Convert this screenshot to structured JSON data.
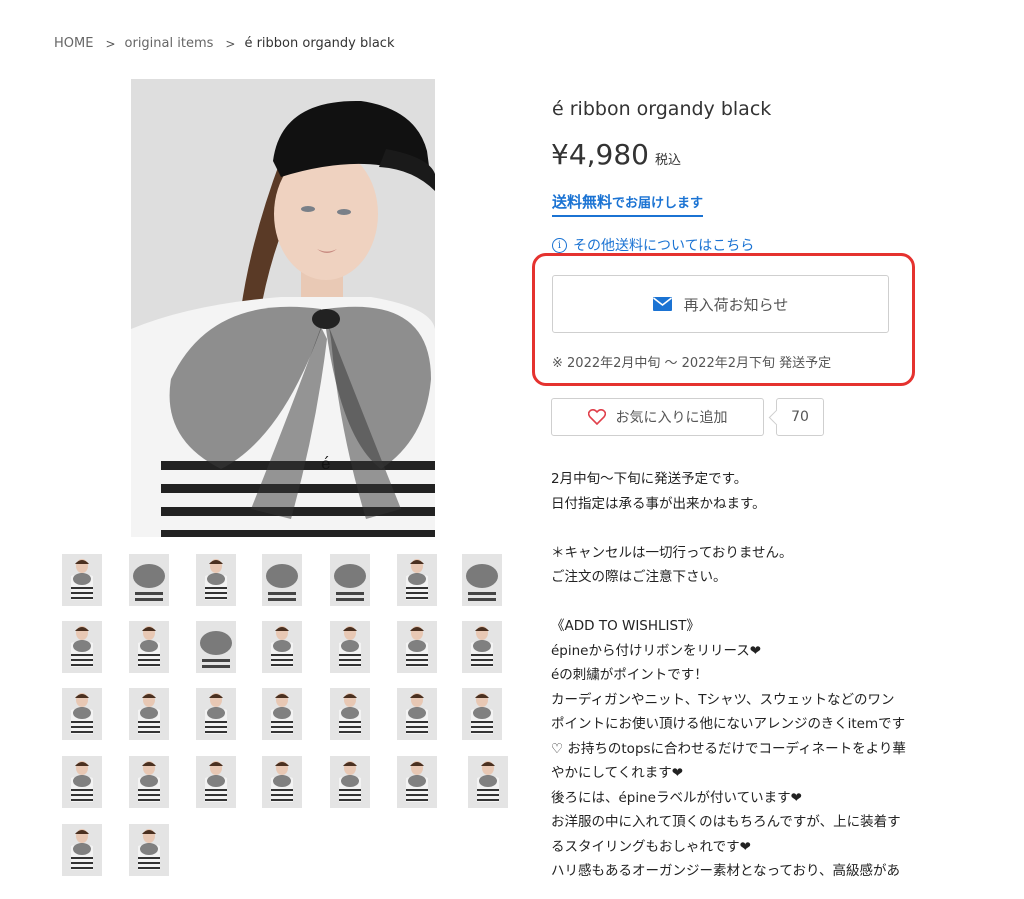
{
  "breadcrumb": {
    "home": "HOME",
    "category": "original items",
    "current": "é ribbon organdy black",
    "separator": ">"
  },
  "product": {
    "title": "é ribbon organdy black",
    "price": "¥4,980",
    "tax_label": "税込",
    "free_shipping_strong": "送料無料",
    "free_shipping_rest": "でお届けします",
    "other_shipping_link": "その他送料についてはこちら",
    "info_icon_glyph": "i",
    "restock_button": "再入荷お知らせ",
    "ship_schedule": "※ 2022年2月中旬 ～ 2022年2月下旬 発送予定",
    "favorite_button": "お気に入りに追加",
    "favorite_count": "70"
  },
  "description": [
    "2月中旬〜下旬に発送予定です。",
    "日付指定は承る事が出来かねます。",
    "",
    "＊キャンセルは一切行っておりません。",
    "ご注文の際はご注意下さい。",
    "",
    "《ADD TO WISHLIST》",
    "épineから付けリボンをリリース❤",
    "éの刺繍がポイントです！",
    "カーディガンやニット、Tシャツ、スウェットなどのワン",
    "ポイントにお使い頂ける他にないアレンジのきくitemです",
    "♡ お持ちのtopsに合わせるだけでコーディネートをより華",
    "やかにしてくれます❤",
    "後ろには、épineラベルが付いています❤",
    "お洋服の中に入れて頂くのはもちろんですが、上に装着す",
    "るスタイリングもおしゃれです❤",
    "ハリ感もあるオーガンジー素材となっており、高級感があ"
  ],
  "colors": {
    "accent_blue": "#1b73d3",
    "highlight_red": "#e5322f",
    "heart_red": "#e0404b"
  },
  "icons": {
    "restock": "envelope-icon",
    "favorite": "heart-icon",
    "info": "info-circle-icon",
    "breadcrumb": "chevron-right-icon"
  },
  "thumbnails": [
    "full",
    "bow",
    "full",
    "bow",
    "bow",
    "full",
    "bow",
    "full",
    "full",
    "bow",
    "full",
    "full",
    "full",
    "full",
    "full",
    "full",
    "full",
    "full",
    "full",
    "full",
    "full",
    "full",
    "full",
    "full",
    "full",
    "full",
    "full",
    "full",
    "full",
    "full"
  ]
}
